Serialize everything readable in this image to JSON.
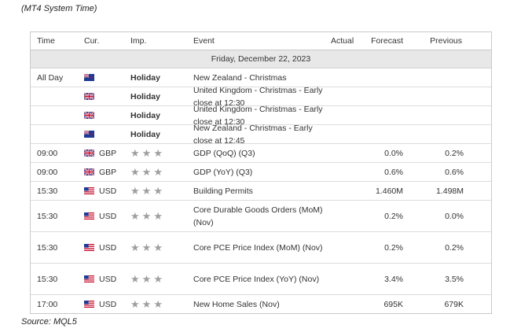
{
  "captions": {
    "top": "(MT4 System Time)",
    "bottom": "Source: MQL5"
  },
  "header": {
    "time": "Time",
    "cur": "Cur.",
    "imp": "Imp.",
    "event": "Event",
    "actual": "Actual",
    "forecast": "Forecast",
    "previous": "Previous"
  },
  "day_label": "Friday, December 22, 2023",
  "icons": {
    "nz_flag": "nz-flag-icon",
    "uk_flag": "uk-flag-icon",
    "us_flag": "us-flag-icon",
    "importance_star": "star-icon"
  },
  "colors": {
    "star": "#9e9e9e",
    "day_bar": "#e8e8e8",
    "border": "#c9c9c9"
  },
  "rows": [
    {
      "time": "All Day",
      "flag": "nz",
      "cur": "",
      "imp": "Holiday",
      "event": "New Zealand - Christmas",
      "actual": "",
      "forecast": "",
      "previous": ""
    },
    {
      "time": "",
      "flag": "uk",
      "cur": "",
      "imp": "Holiday",
      "event": "United Kingdom - Christmas - Early close at 12:30",
      "actual": "",
      "forecast": "",
      "previous": ""
    },
    {
      "time": "",
      "flag": "uk",
      "cur": "",
      "imp": "Holiday",
      "event": "United Kingdom - Christmas - Early close at 12:30",
      "actual": "",
      "forecast": "",
      "previous": ""
    },
    {
      "time": "",
      "flag": "nz",
      "cur": "",
      "imp": "Holiday",
      "event": "New Zealand - Christmas - Early close at 12:45",
      "actual": "",
      "forecast": "",
      "previous": ""
    },
    {
      "time": "09:00",
      "flag": "uk",
      "cur": "GBP",
      "imp": "",
      "event": "GDP (QoQ) (Q3)",
      "actual": "",
      "forecast": "0.0%",
      "previous": "0.2%"
    },
    {
      "time": "09:00",
      "flag": "uk",
      "cur": "GBP",
      "imp": "",
      "event": "GDP (YoY) (Q3)",
      "actual": "",
      "forecast": "0.6%",
      "previous": "0.6%"
    },
    {
      "time": "15:30",
      "flag": "us",
      "cur": "USD",
      "imp": "",
      "event": "Building Permits",
      "actual": "",
      "forecast": "1.460M",
      "previous": "1.498M"
    },
    {
      "time": "15:30",
      "flag": "us",
      "cur": "USD",
      "imp": "",
      "event": "Core Durable Goods Orders (MoM) (Nov)",
      "actual": "",
      "forecast": "0.2%",
      "previous": "0.0%"
    },
    {
      "time": "15:30",
      "flag": "us",
      "cur": "USD",
      "imp": "",
      "event": "Core PCE Price Index (MoM) (Nov)",
      "actual": "",
      "forecast": "0.2%",
      "previous": "0.2%"
    },
    {
      "time": "15:30",
      "flag": "us",
      "cur": "USD",
      "imp": "",
      "event": "Core PCE Price Index (YoY) (Nov)",
      "actual": "",
      "forecast": "3.4%",
      "previous": "3.5%"
    },
    {
      "time": "17:00",
      "flag": "us",
      "cur": "USD",
      "imp": "",
      "event": "New Home Sales (Nov)",
      "actual": "",
      "forecast": "695K",
      "previous": "679K"
    }
  ]
}
